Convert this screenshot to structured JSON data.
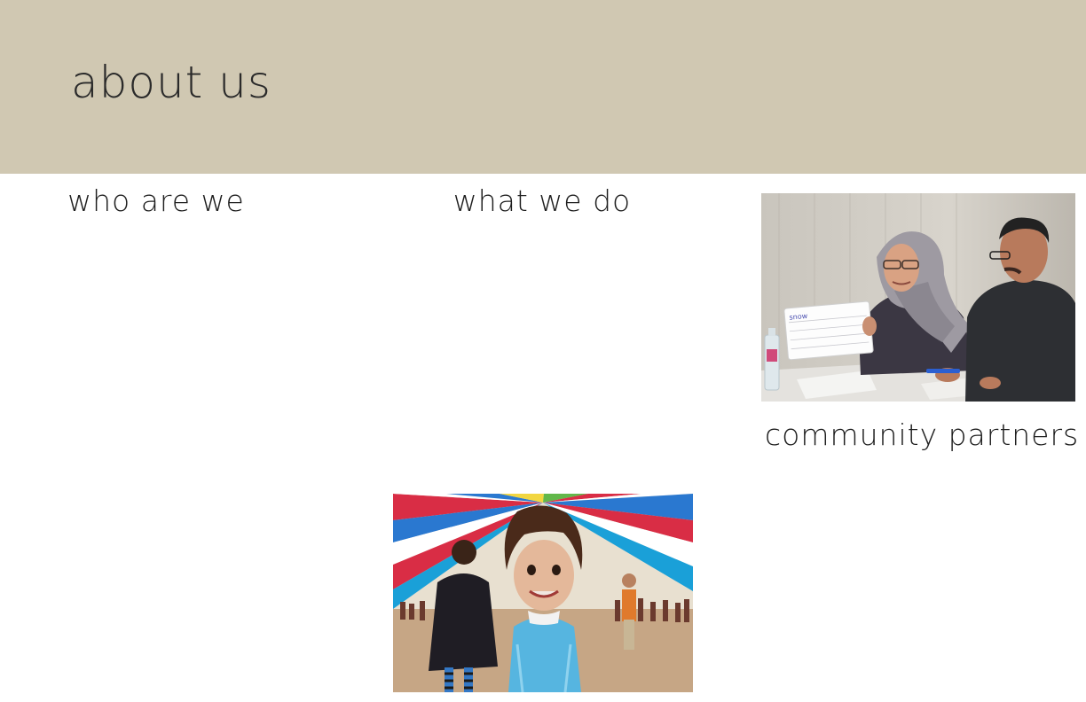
{
  "header": {
    "title": "about us",
    "band_color": "#d0c8b2"
  },
  "sections": {
    "who_are_we": "who are we",
    "what_we_do": "what we do",
    "community_partners": "community partners"
  },
  "images": {
    "classroom_photo": {
      "icon": "photo-icon",
      "whiteboard_text": "snow"
    },
    "parachute_photo": {
      "icon": "photo-icon"
    }
  }
}
